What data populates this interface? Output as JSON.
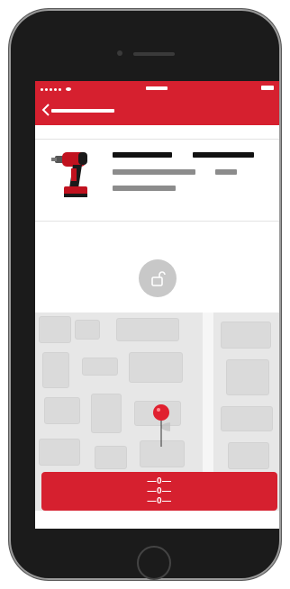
{
  "app": {
    "brand_color": "#d6202f",
    "nav_back_icon": "chevron-left-icon"
  },
  "product": {
    "image_icon": "power-drill-icon"
  },
  "lock": {
    "icon": "unlock-icon",
    "bg": "#c8c8c8"
  },
  "map": {
    "pin_icon": "map-pin-icon",
    "pin_color": "#e0202f"
  },
  "action": {
    "label": "—0—\n—0—\n—0—"
  }
}
